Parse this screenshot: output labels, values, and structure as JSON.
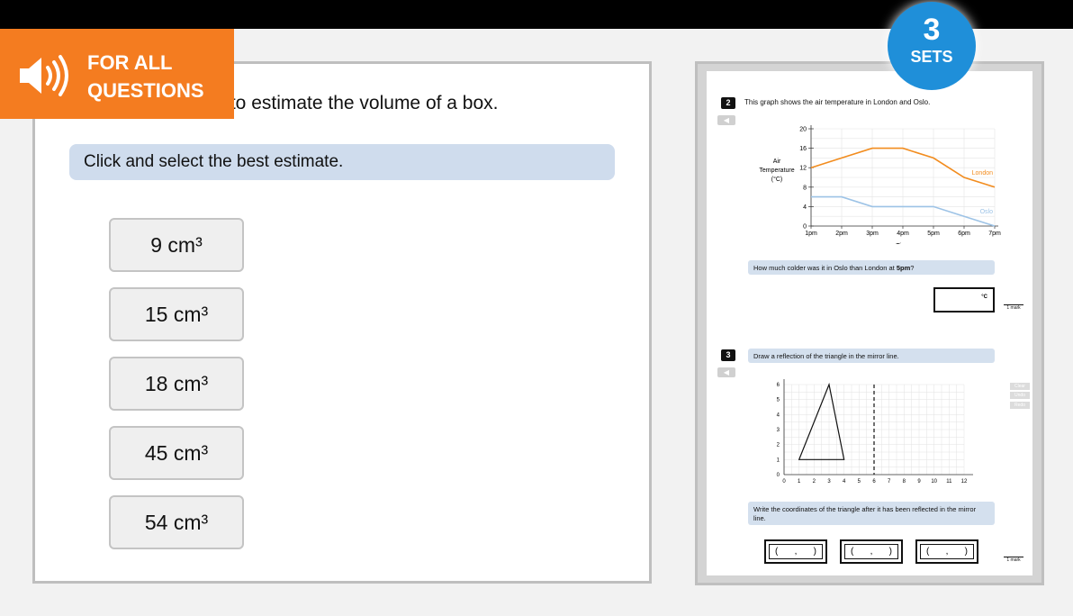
{
  "banner": {
    "line1": "FOR ALL",
    "line2": "QUESTIONS",
    "icon": "speaker-icon",
    "color": "#f47c20"
  },
  "badge": {
    "number": "3",
    "label": "SETS",
    "color": "#1f8fd9"
  },
  "left": {
    "question": "ubes to estimate the volume of a box.",
    "instruction": "Click and select the best estimate.",
    "options": [
      "9 cm³",
      "15 cm³",
      "18 cm³",
      "45 cm³",
      "54 cm³"
    ]
  },
  "right": {
    "q2": {
      "number": "2",
      "text": "This graph shows the air temperature in London and Oslo.",
      "prompt_pre": "How much colder was it in Oslo than London at ",
      "prompt_bold": "5pm",
      "prompt_post": "?",
      "unit": "°C",
      "mark": "1 mark"
    },
    "q3": {
      "number": "3",
      "text": "Draw a reflection of the triangle in the mirror line.",
      "prompt": "Write the coordinates of the triangle after it has been reflected in the mirror line.",
      "mark": "1 mark",
      "controls": [
        "Clear",
        "Undo",
        "Redo"
      ],
      "coord_open": "(",
      "coord_sep": ",",
      "coord_close": ")"
    }
  },
  "chart_data": [
    {
      "type": "line",
      "title": "",
      "xlabel": "Time",
      "ylabel": "Air Temperature (°C)",
      "categories": [
        "1pm",
        "2pm",
        "3pm",
        "4pm",
        "5pm",
        "6pm",
        "7pm"
      ],
      "ylim": [
        0,
        20
      ],
      "yticks": [
        0,
        4,
        8,
        12,
        16,
        20
      ],
      "grid": true,
      "series": [
        {
          "name": "London",
          "values": [
            12,
            14,
            16,
            16,
            14,
            10,
            8
          ],
          "color": "#f28c1e"
        },
        {
          "name": "Oslo",
          "values": [
            6,
            6,
            4,
            4,
            4,
            2,
            0
          ],
          "color": "#9dc3e6"
        }
      ]
    },
    {
      "type": "scatter",
      "title": "",
      "xlim": [
        0,
        12
      ],
      "ylim": [
        0,
        6
      ],
      "xticks": [
        0,
        1,
        2,
        3,
        4,
        5,
        6,
        7,
        8,
        9,
        10,
        11,
        12
      ],
      "yticks": [
        0,
        1,
        2,
        3,
        4,
        5,
        6
      ],
      "grid": true,
      "triangle": [
        [
          1,
          1
        ],
        [
          4,
          1
        ],
        [
          3,
          6
        ]
      ],
      "mirror_line_x": 6
    }
  ]
}
